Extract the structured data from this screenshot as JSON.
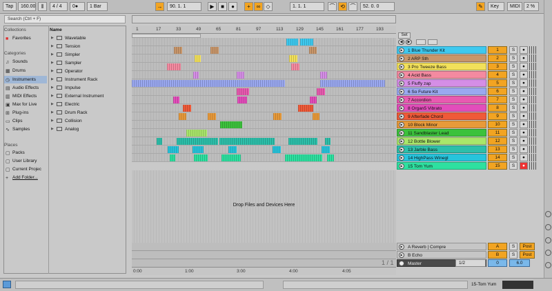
{
  "transport": {
    "tap": "Tap",
    "tempo": "160.00",
    "signature": "4 / 4",
    "metro_dots": "0●",
    "quantize": "1 Bar",
    "position": "90. 1. 1",
    "loop_start": "1. 1. 1",
    "loop_len": "52. 0. 0",
    "key": "Key",
    "midi": "MIDI",
    "cpu": "2 %"
  },
  "browser": {
    "search_placeholder": "Search (Ctrl + F)",
    "collections_head": "Collections",
    "favorites": "Favorites",
    "categories_head": "Categories",
    "categories": [
      "Sounds",
      "Drums",
      "Instruments",
      "Audio Effects",
      "MIDI Effects",
      "Max for Live",
      "Plug-ins",
      "Clips",
      "Samples"
    ],
    "places_head": "Places",
    "places": [
      "Packs",
      "User Library",
      "Current Projec",
      "Add Folder..."
    ],
    "name_head": "Name",
    "items": [
      "Wavetable",
      "Tension",
      "Simpler",
      "Sampler",
      "Operator",
      "Instrument Rack",
      "Impulse",
      "External Instrument",
      "Electric",
      "Drum Rack",
      "Collision",
      "Analog"
    ]
  },
  "arrangement": {
    "ruler": [
      "1",
      "17",
      "33",
      "49",
      "65",
      "81",
      "97",
      "113",
      "129",
      "145",
      "161",
      "177",
      "193"
    ],
    "time_ruler": [
      "0:00",
      "1:00",
      "3:00",
      "4:00",
      "4:05"
    ],
    "drop_text": "Drop Files and Devices Here",
    "page": "1 / 1",
    "set_label": "Set"
  },
  "tracks": [
    {
      "name": "1 Blue Thunder Kit",
      "num": "1",
      "color": "#3ec9ef"
    },
    {
      "name": "2 ARP Sth",
      "num": "2",
      "color": "#c8966a"
    },
    {
      "name": "3 Pro Tweeze Bass",
      "num": "3",
      "color": "#f2e05a"
    },
    {
      "name": "4 Acid Bass",
      "num": "4",
      "color": "#f48aa0"
    },
    {
      "name": "5 Fluffy zap",
      "num": "5",
      "color": "#d58ee6"
    },
    {
      "name": "6 So Future Kit",
      "num": "6",
      "color": "#9aa8f0"
    },
    {
      "name": "7 Accordion",
      "num": "7",
      "color": "#e85ab0"
    },
    {
      "name": "8 Organ5 Vibrato",
      "num": "8",
      "color": "#e34dbb"
    },
    {
      "name": "9 Afterfade Chord",
      "num": "9",
      "color": "#ef5a38"
    },
    {
      "name": "10 Block Minor",
      "num": "10",
      "color": "#e89a3a"
    },
    {
      "name": "11 Sandblaster Lead",
      "num": "11",
      "color": "#3cc23c"
    },
    {
      "name": "12 Bottle Blower",
      "num": "12",
      "color": "#a9e66a"
    },
    {
      "name": "13 Jarble Bass",
      "num": "13",
      "color": "#2dbfaa"
    },
    {
      "name": "14 HighPass Winegl",
      "num": "14",
      "color": "#27c4dc"
    },
    {
      "name": "15 Tom Yum",
      "num": "15",
      "color": "#2ee0a0"
    }
  ],
  "returns": [
    {
      "name": "A Reverb | Compre",
      "num": "A",
      "post": "Post"
    },
    {
      "name": "B Echo",
      "num": "B",
      "post": "Post"
    }
  ],
  "master": {
    "name": "Master",
    "routing": "1/2",
    "vol": "0",
    "pan": "6.0"
  },
  "status": {
    "selected": "15-Tom Yum"
  }
}
